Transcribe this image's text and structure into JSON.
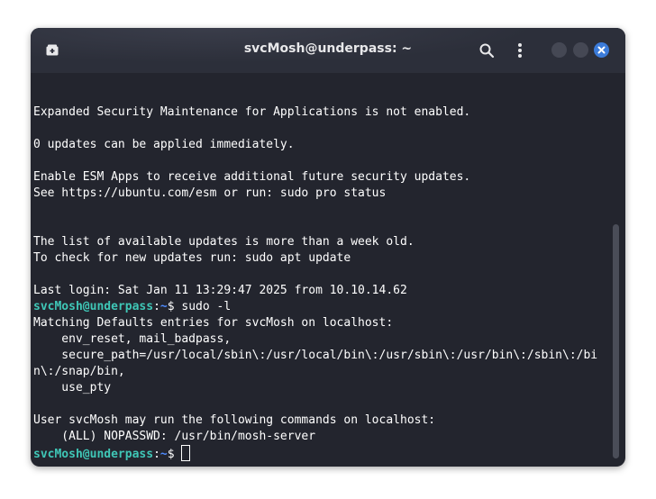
{
  "window": {
    "title": "svcMosh@underpass: ~",
    "accent_close": "#3b7bd9"
  },
  "icons": {
    "new_tab": "new-tab-icon",
    "search": "search-icon",
    "menu": "kebab-menu-icon",
    "minimize": "minimize-icon",
    "maximize": "maximize-icon",
    "close": "close-icon"
  },
  "terminal": {
    "lines": [
      {
        "text": "Expanded Security Maintenance for Applications is not enabled."
      },
      {
        "text": "0 updates can be applied immediately."
      },
      {
        "text": "Enable ESM Apps to receive additional future security updates."
      },
      {
        "text": "See https://ubuntu.com/esm or run: sudo pro status"
      },
      {
        "text": "The list of available updates is more than a week old."
      },
      {
        "text": "To check for new updates run: sudo apt update"
      },
      {
        "text": "Last login: Sat Jan 11 13:29:47 2025 from 10.10.14.62"
      },
      {
        "prompt_user": "svcMosh@underpass",
        "prompt_sep": ":",
        "prompt_path": "~",
        "prompt_end": "$ ",
        "command": "sudo -l"
      },
      {
        "text": "Matching Defaults entries for svcMosh on localhost:"
      },
      {
        "text": "    env_reset, mail_badpass,"
      },
      {
        "text": "    secure_path=/usr/local/sbin\\:/usr/local/bin\\:/usr/sbin\\:/usr/bin\\:/sbin\\:/bi"
      },
      {
        "text": "n\\:/snap/bin,"
      },
      {
        "text": "    use_pty"
      },
      {
        "text": "User svcMosh may run the following commands on localhost:"
      },
      {
        "text": "    (ALL) NOPASSWD: /usr/bin/mosh-server"
      },
      {
        "prompt_user": "svcMosh@underpass",
        "prompt_sep": ":",
        "prompt_path": "~",
        "prompt_end": "$ ",
        "command": ""
      }
    ]
  }
}
